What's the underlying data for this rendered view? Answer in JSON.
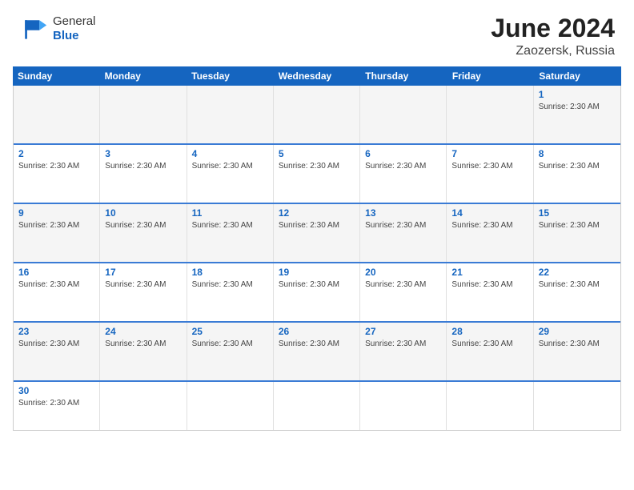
{
  "header": {
    "logo_general": "General",
    "logo_blue": "Blue",
    "month_year": "June 2024",
    "location": "Zaozersk, Russia"
  },
  "calendar": {
    "days_of_week": [
      "Sunday",
      "Monday",
      "Tuesday",
      "Wednesday",
      "Thursday",
      "Friday",
      "Saturday"
    ],
    "rows": [
      {
        "cells": [
          {
            "day": "",
            "info": "",
            "empty": true
          },
          {
            "day": "",
            "info": "",
            "empty": true
          },
          {
            "day": "",
            "info": "",
            "empty": true
          },
          {
            "day": "",
            "info": "",
            "empty": true
          },
          {
            "day": "",
            "info": "",
            "empty": true
          },
          {
            "day": "",
            "info": "",
            "empty": true
          },
          {
            "day": "1",
            "info": "Sunrise: 2:30 AM",
            "empty": false
          }
        ]
      },
      {
        "cells": [
          {
            "day": "2",
            "info": "Sunrise: 2:30 AM",
            "empty": false
          },
          {
            "day": "3",
            "info": "Sunrise: 2:30 AM",
            "empty": false
          },
          {
            "day": "4",
            "info": "Sunrise: 2:30 AM",
            "empty": false
          },
          {
            "day": "5",
            "info": "Sunrise: 2:30 AM",
            "empty": false
          },
          {
            "day": "6",
            "info": "Sunrise: 2:30 AM",
            "empty": false
          },
          {
            "day": "7",
            "info": "Sunrise: 2:30 AM",
            "empty": false
          },
          {
            "day": "8",
            "info": "Sunrise: 2:30 AM",
            "empty": false
          }
        ]
      },
      {
        "cells": [
          {
            "day": "9",
            "info": "Sunrise: 2:30 AM",
            "empty": false
          },
          {
            "day": "10",
            "info": "Sunrise: 2:30 AM",
            "empty": false
          },
          {
            "day": "11",
            "info": "Sunrise: 2:30 AM",
            "empty": false
          },
          {
            "day": "12",
            "info": "Sunrise: 2:30 AM",
            "empty": false
          },
          {
            "day": "13",
            "info": "Sunrise: 2:30 AM",
            "empty": false
          },
          {
            "day": "14",
            "info": "Sunrise: 2:30 AM",
            "empty": false
          },
          {
            "day": "15",
            "info": "Sunrise: 2:30 AM",
            "empty": false
          }
        ]
      },
      {
        "cells": [
          {
            "day": "16",
            "info": "Sunrise: 2:30 AM",
            "empty": false
          },
          {
            "day": "17",
            "info": "Sunrise: 2:30 AM",
            "empty": false
          },
          {
            "day": "18",
            "info": "Sunrise: 2:30 AM",
            "empty": false
          },
          {
            "day": "19",
            "info": "Sunrise: 2:30 AM",
            "empty": false
          },
          {
            "day": "20",
            "info": "Sunrise: 2:30 AM",
            "empty": false
          },
          {
            "day": "21",
            "info": "Sunrise: 2:30 AM",
            "empty": false
          },
          {
            "day": "22",
            "info": "Sunrise: 2:30 AM",
            "empty": false
          }
        ]
      },
      {
        "cells": [
          {
            "day": "23",
            "info": "Sunrise: 2:30 AM",
            "empty": false
          },
          {
            "day": "24",
            "info": "Sunrise: 2:30 AM",
            "empty": false
          },
          {
            "day": "25",
            "info": "Sunrise: 2:30 AM",
            "empty": false
          },
          {
            "day": "26",
            "info": "Sunrise: 2:30 AM",
            "empty": false
          },
          {
            "day": "27",
            "info": "Sunrise: 2:30 AM",
            "empty": false
          },
          {
            "day": "28",
            "info": "Sunrise: 2:30 AM",
            "empty": false
          },
          {
            "day": "29",
            "info": "Sunrise: 2:30 AM",
            "empty": false
          }
        ]
      },
      {
        "cells": [
          {
            "day": "30",
            "info": "Sunrise: 2:30 AM",
            "empty": false
          },
          {
            "day": "",
            "info": "",
            "empty": true
          },
          {
            "day": "",
            "info": "",
            "empty": true
          },
          {
            "day": "",
            "info": "",
            "empty": true
          },
          {
            "day": "",
            "info": "",
            "empty": true
          },
          {
            "day": "",
            "info": "",
            "empty": true
          },
          {
            "day": "",
            "info": "",
            "empty": true
          }
        ]
      }
    ]
  }
}
